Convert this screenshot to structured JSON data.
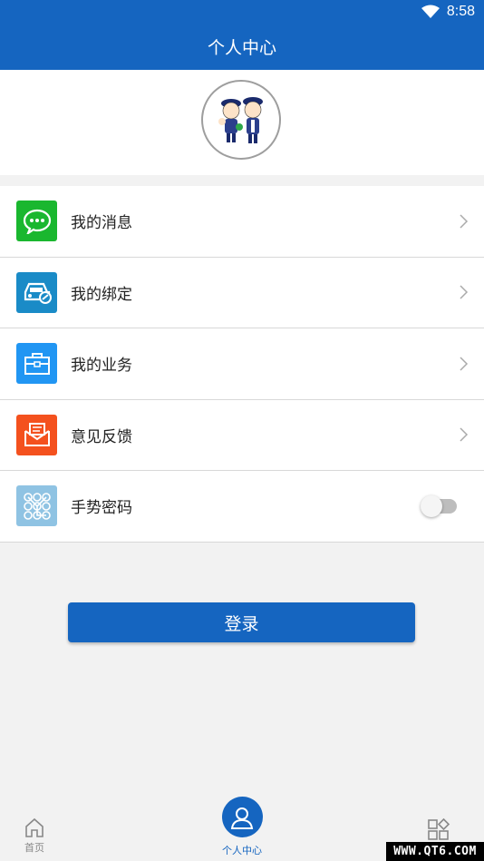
{
  "status_bar": {
    "time": "8:58"
  },
  "header": {
    "title": "个人中心"
  },
  "avatar": {
    "icon": "police-mascot-icon"
  },
  "menu": {
    "items": [
      {
        "label": "我的消息",
        "icon": "message-icon",
        "color": "#1ab72f",
        "trailing": "chevron"
      },
      {
        "label": "我的绑定",
        "icon": "car-icon",
        "color": "#1a8bc7",
        "trailing": "chevron"
      },
      {
        "label": "我的业务",
        "icon": "briefcase-icon",
        "color": "#2196f3",
        "trailing": "chevron"
      },
      {
        "label": "意见反馈",
        "icon": "mail-icon",
        "color": "#f4511e",
        "trailing": "chevron"
      },
      {
        "label": "手势密码",
        "icon": "gesture-grid-icon",
        "color": "#8fc3e3",
        "trailing": "toggle",
        "toggle_on": false
      }
    ]
  },
  "login": {
    "label": "登录"
  },
  "bottom_nav": {
    "home": {
      "label": "首页"
    },
    "profile": {
      "label": "个人中心"
    },
    "apps": {
      "icon": "apps-icon"
    }
  },
  "watermark": {
    "text": "WWW.QT6.COM"
  },
  "colors": {
    "primary": "#1565c0",
    "background": "#f2f2f2"
  }
}
